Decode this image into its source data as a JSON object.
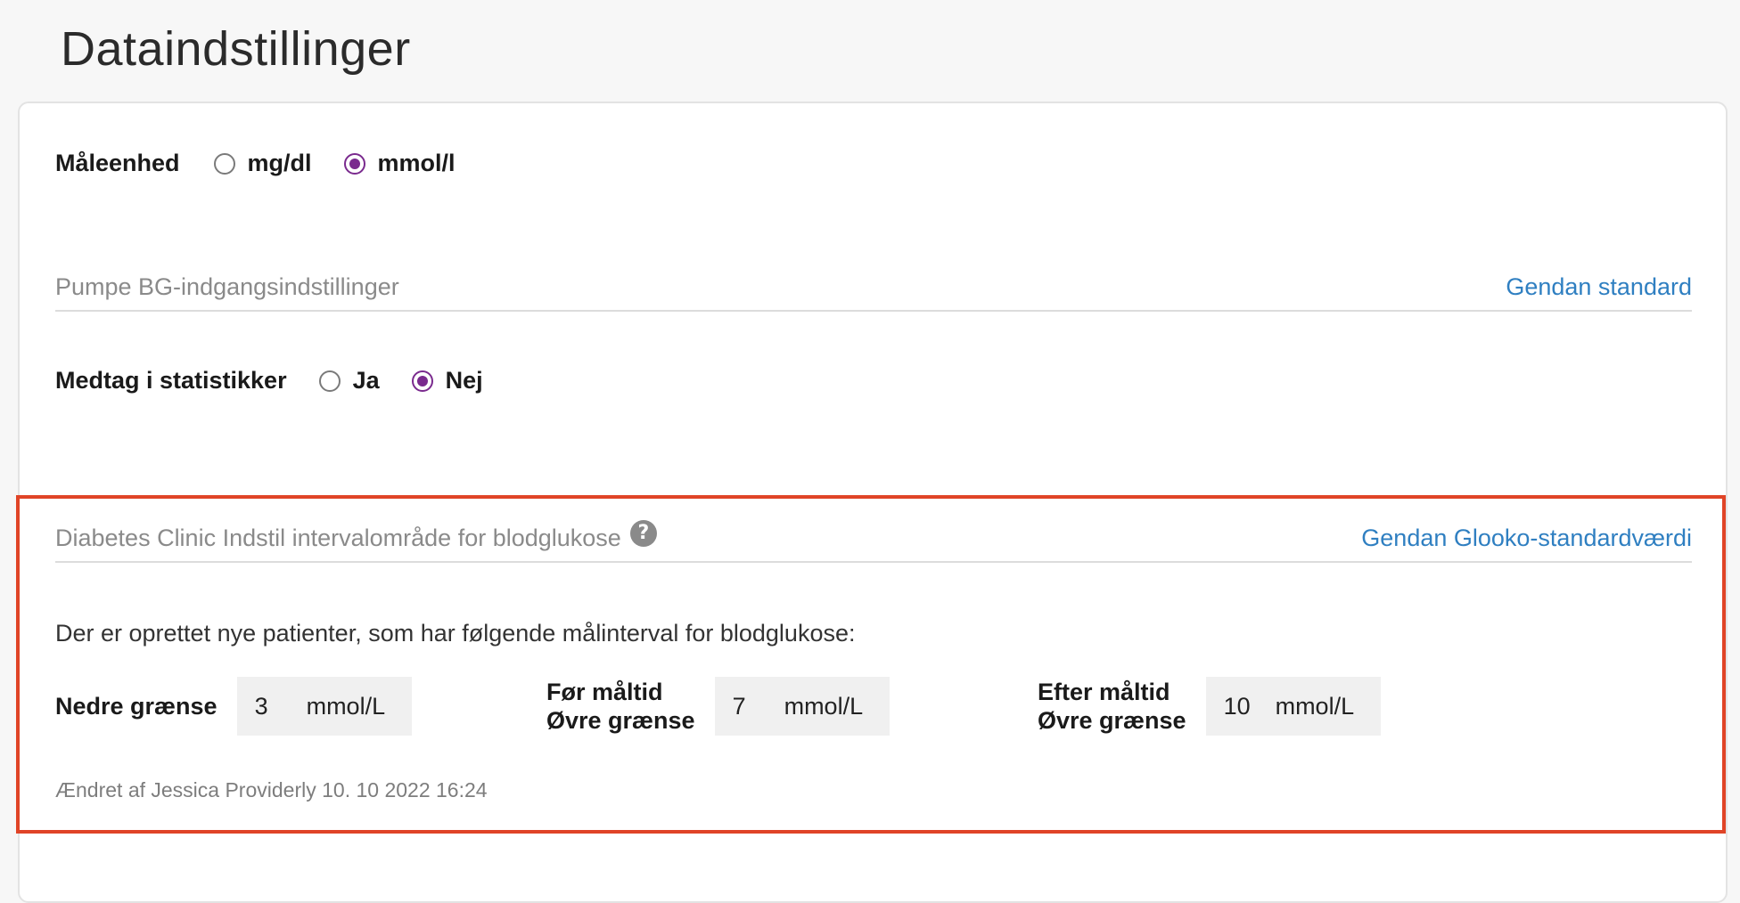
{
  "page": {
    "title": "Dataindstillinger"
  },
  "unit": {
    "label": "Måleenhed",
    "options": [
      {
        "label": "mg/dl",
        "checked": false
      },
      {
        "label": "mmol/l",
        "checked": true
      }
    ]
  },
  "pump_section": {
    "title": "Pumpe BG-indgangsindstillinger",
    "reset_link": "Gendan standard",
    "include_label": "Medtag i statistikker",
    "options": [
      {
        "label": "Ja",
        "checked": false
      },
      {
        "label": "Nej",
        "checked": true
      }
    ]
  },
  "range_section": {
    "title": "Diabetes Clinic Indstil intervalområde for blodglukose",
    "help_icon": "question-circle-icon",
    "reset_link": "Gendan Glooko-standardværdi",
    "intro": "Der er oprettet nye patienter, som har følgende målinterval for blodglukose:",
    "lower": {
      "label_line1": "Nedre grænse",
      "value": "3",
      "unit": "mmol/L"
    },
    "before_meal": {
      "label_line1": "Før måltid",
      "label_line2": "Øvre grænse",
      "value": "7",
      "unit": "mmol/L"
    },
    "after_meal": {
      "label_line1": "Efter måltid",
      "label_line2": "Øvre grænse",
      "value": "10",
      "unit": "mmol/L"
    },
    "changed_by": "Ændret af Jessica Providerly 10. 10 2022 16:24"
  },
  "colors": {
    "accent": "#7a2a8e",
    "link": "#2f7fc1",
    "highlight": "#e04427"
  }
}
